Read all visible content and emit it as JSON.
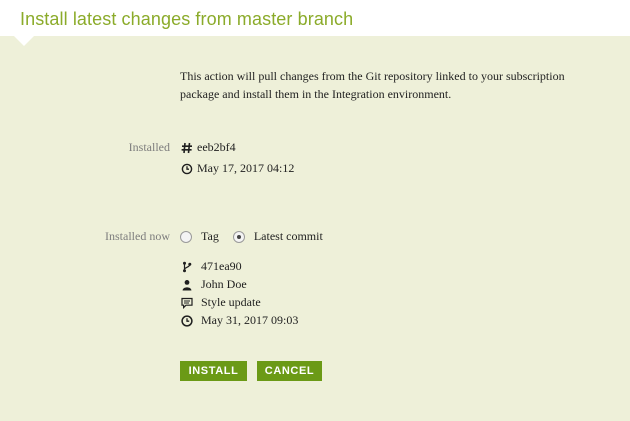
{
  "header": {
    "title": "Install latest changes from master branch"
  },
  "description": "This action will pull changes from the Git repository linked to your subscription package and install them in the Integration environment.",
  "installed": {
    "label": "Installed",
    "commit_hash": "eeb2bf4",
    "date": "May 17, 2017 04:12",
    "hash_icon": "hash-icon",
    "clock_icon": "clock-icon"
  },
  "installed_now": {
    "label": "Installed now",
    "options": [
      {
        "label": "Tag",
        "checked": false
      },
      {
        "label": "Latest commit",
        "checked": true
      }
    ],
    "commit": {
      "hash": "471ea90",
      "author": "John Doe",
      "message": "Style update",
      "date": "May 31, 2017 09:03"
    },
    "icons": [
      "branch-icon",
      "user-icon",
      "comment-icon",
      "clock-icon"
    ]
  },
  "buttons": {
    "install": "INSTALL",
    "cancel": "CANCEL"
  },
  "colors": {
    "accent": "#8bab2a",
    "button": "#6b9a16",
    "background": "#eef0d9"
  }
}
